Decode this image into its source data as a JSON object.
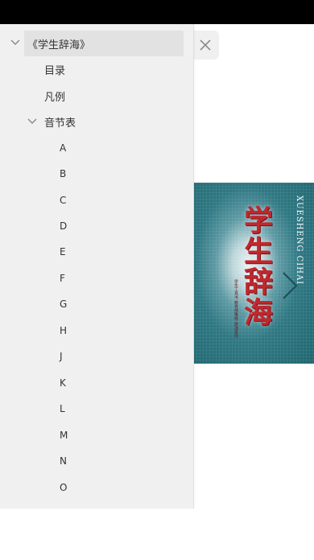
{
  "close_button": {
    "icon": "close-icon"
  },
  "toc": {
    "root": {
      "label": "《学生辞海》",
      "expanded": true
    },
    "items": [
      {
        "label": "目录"
      },
      {
        "label": "凡例"
      },
      {
        "label": "音节表",
        "expanded": true
      }
    ],
    "letters": [
      "A",
      "B",
      "C",
      "D",
      "E",
      "F",
      "G",
      "H",
      "J",
      "K",
      "L",
      "M",
      "N",
      "O"
    ]
  },
  "cover": {
    "title": "学生辞海",
    "pinyin": "XUESHENG CIHAI",
    "small_text": "学生工具书 教育部推荐 辞海系列",
    "colors": {
      "title": "#c0282e",
      "background": "#20666f"
    }
  }
}
